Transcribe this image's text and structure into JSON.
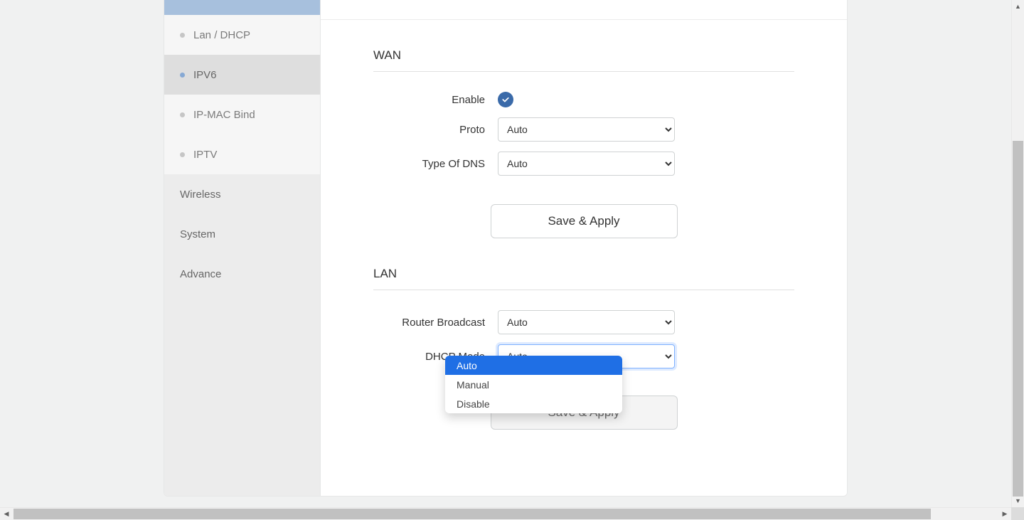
{
  "sidebar": {
    "subitems": [
      {
        "label": "Lan / DHCP"
      },
      {
        "label": "IPV6"
      },
      {
        "label": "IP-MAC Bind"
      },
      {
        "label": "IPTV"
      }
    ],
    "items": [
      {
        "label": "Wireless"
      },
      {
        "label": "System"
      },
      {
        "label": "Advance"
      }
    ]
  },
  "wan": {
    "title": "WAN",
    "enable_label": "Enable",
    "enable_value": true,
    "proto_label": "Proto",
    "proto_value": "Auto",
    "dns_label": "Type Of DNS",
    "dns_value": "Auto",
    "save_label": "Save & Apply"
  },
  "lan": {
    "title": "LAN",
    "router_broadcast_label": "Router Broadcast",
    "router_broadcast_value": "Auto",
    "dhcp_mode_label": "DHCP Mode",
    "dhcp_mode_value": "Auto",
    "dhcp_mode_options": [
      "Auto",
      "Manual",
      "Disable"
    ],
    "save_label": "Save & Apply"
  }
}
